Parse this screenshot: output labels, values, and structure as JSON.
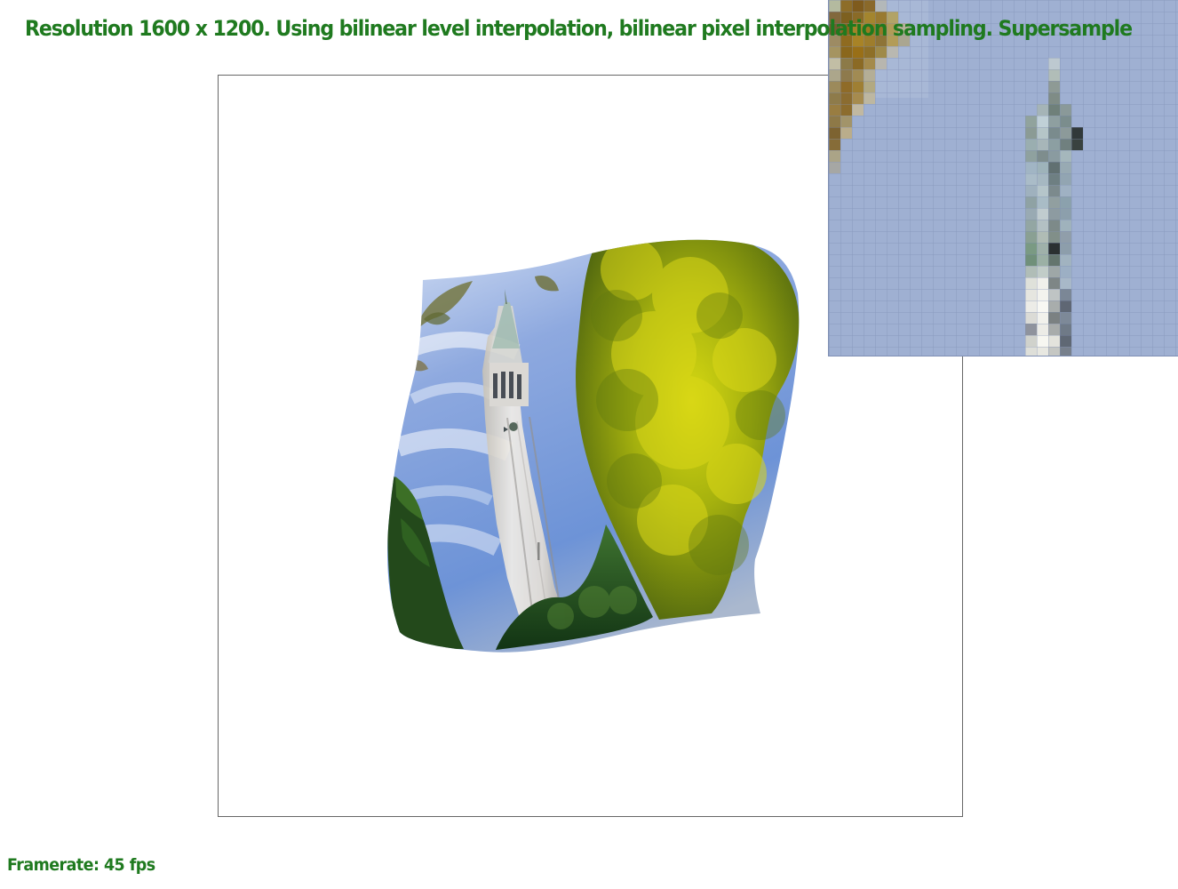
{
  "status": {
    "header_text": "Resolution 1600 x 1200. Using bilinear level interpolation, bilinear pixel interpolation sampling. Supersample",
    "footer_text": "Framerate: 45 fps"
  },
  "colors": {
    "status_text": "#1f7a1f",
    "sky_light": "#dfe8f7",
    "sky_blue": "#6d93d7",
    "tower_white": "#e8e3da",
    "tree_yellow_green": "#a2b20e",
    "tree_dark_green": "#214a18",
    "zoom_background": "#9fb0d2"
  }
}
